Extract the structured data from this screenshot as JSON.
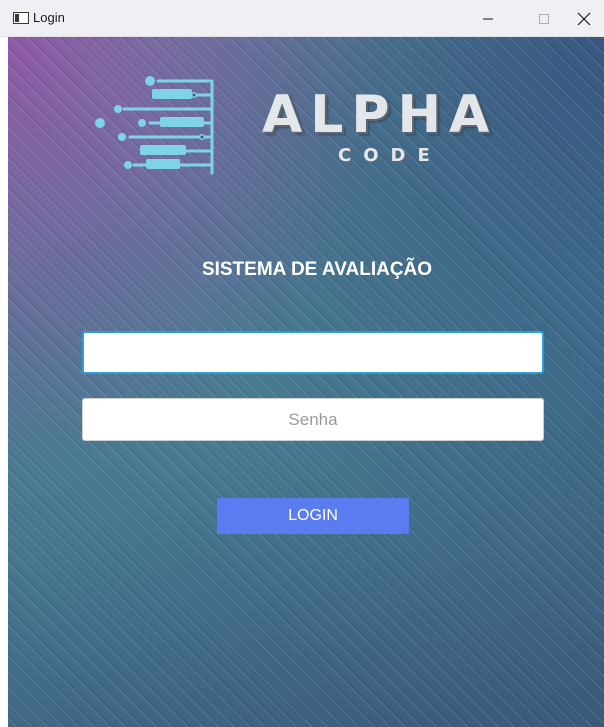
{
  "window": {
    "title": "Login",
    "icon": "app-window-icon",
    "controls": {
      "minimize_icon": "minimize-icon",
      "maximize_icon": "maximize-icon",
      "close_icon": "close-icon"
    }
  },
  "logo": {
    "word": "ALPHA",
    "sub": "CODE",
    "graphic_icon": "circuit-logo-icon"
  },
  "form": {
    "heading": "SISTEMA DE AVALIAÇÃO",
    "username": {
      "value": "",
      "placeholder": ""
    },
    "password": {
      "value": "",
      "placeholder": "Senha"
    },
    "login_label": "LOGIN"
  },
  "colors": {
    "accent_button": "#5b7bf0",
    "focus_border": "#2a9fd8",
    "logo_cyan": "#7fd3e6"
  }
}
